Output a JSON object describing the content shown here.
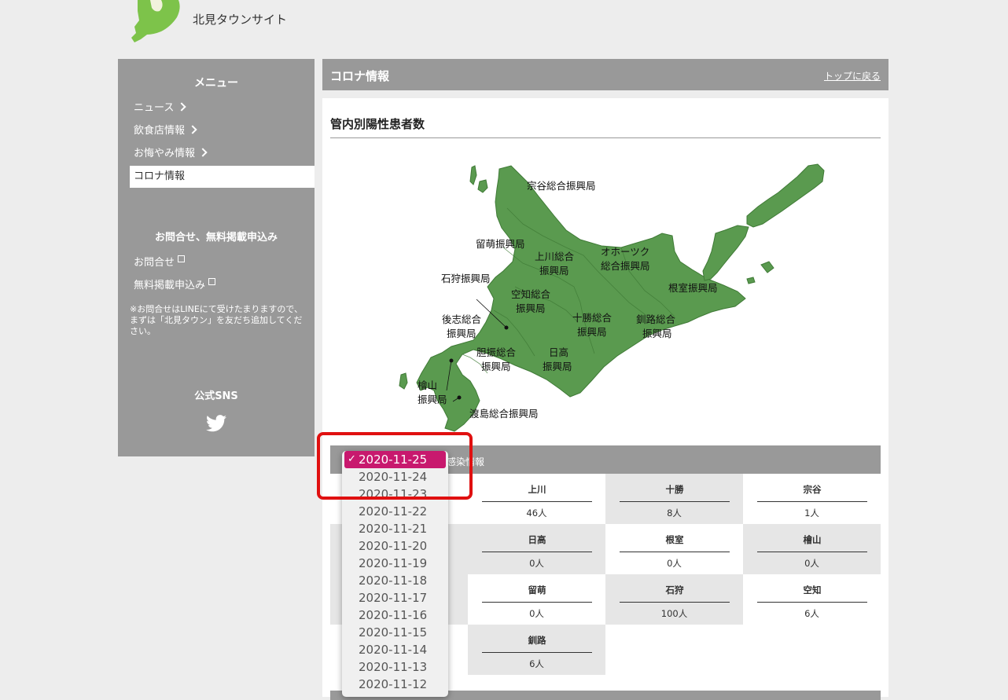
{
  "site": {
    "title": "北見タウンサイト"
  },
  "sidebar": {
    "menu_title": "メニュー",
    "items": [
      {
        "label": "ニュース",
        "chevron": true
      },
      {
        "label": "飲食店情報",
        "chevron": true
      },
      {
        "label": "お悔やみ情報",
        "chevron": true
      },
      {
        "label": "コロナ情報",
        "chevron": false,
        "active": true
      }
    ],
    "contact_title": "お問合せ、無料掲載申込み",
    "contact_links": [
      "お問合せ",
      "無料掲載申込み"
    ],
    "note": "※お問合せはLINEにて受けたまりますので、まずは「北見タウン」を友だち追加してください。",
    "sns_title": "公式SNS",
    "sns_icon": "twitter-icon"
  },
  "page": {
    "title": "コロナ情報",
    "back_link": "トップに戻る"
  },
  "section": {
    "title": "管内別陽性患者数"
  },
  "map_labels": {
    "souya": "宗谷総合振興局",
    "rumoi": "留萌振興局",
    "kamikawa_1": "上川総合",
    "kamikawa_2": "振興局",
    "okhotsk_1": "オホーツク",
    "okhotsk_2": "総合振興局",
    "ishikari": "石狩振興局",
    "nemuro": "根室振興局",
    "sorachi_1": "空知総合",
    "sorachi_2": "振興局",
    "tokachi_1": "十勝総合",
    "tokachi_2": "振興局",
    "kushiro_1": "釧路総合",
    "kushiro_2": "振興局",
    "shiribeshi_1": "後志総合",
    "shiribeshi_2": "振興局",
    "iburi_1": "胆振総合",
    "iburi_2": "振興局",
    "hidaka_1": "日高",
    "hidaka_2": "振興局",
    "hiyama_1": "檜山",
    "hiyama_2": "振興局",
    "oshima": "渡島総合振興局"
  },
  "info_bar": {
    "label": "感染情報"
  },
  "regions": [
    {
      "name": "上川",
      "value": "46人"
    },
    {
      "name": "十勝",
      "value": "8人"
    },
    {
      "name": "宗谷",
      "value": "1人"
    },
    {
      "name": "日高",
      "value": "0人"
    },
    {
      "name": "根室",
      "value": "0人"
    },
    {
      "name": "檜山",
      "value": "0人"
    },
    {
      "name": "留萌",
      "value": "0人"
    },
    {
      "name": "石狩",
      "value": "100人"
    },
    {
      "name": "空知",
      "value": "6人"
    },
    {
      "name": "釧路",
      "value": "6人"
    }
  ],
  "dropdown": {
    "check": "✓",
    "options": [
      "2020-11-25",
      "2020-11-24",
      "2020-11-23",
      "2020-11-22",
      "2020-11-21",
      "2020-11-20",
      "2020-11-19",
      "2020-11-18",
      "2020-11-17",
      "2020-11-16",
      "2020-11-15",
      "2020-11-14",
      "2020-11-13",
      "2020-11-12"
    ],
    "selected": "2020-11-25"
  },
  "colors": {
    "map_fill": "#5a9a4f",
    "logo": "#7dc34a",
    "selected": "#c8196e",
    "highlight": "#e01010",
    "sidebar": "#999999"
  }
}
